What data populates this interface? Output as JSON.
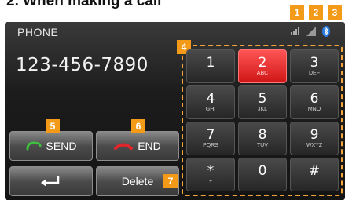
{
  "heading": "2. When making a call",
  "screen": {
    "title": "PHONE",
    "number": "123-456-7890"
  },
  "status_icons": [
    "signal-strength-icon",
    "battery-icon",
    "bluetooth-icon"
  ],
  "callouts": [
    "1",
    "2",
    "3",
    "4",
    "5",
    "6",
    "7"
  ],
  "keypad": [
    {
      "digit": "1",
      "letters": ""
    },
    {
      "digit": "2",
      "letters": "ABC"
    },
    {
      "digit": "3",
      "letters": "DEF"
    },
    {
      "digit": "4",
      "letters": "GHI"
    },
    {
      "digit": "5",
      "letters": "JKL"
    },
    {
      "digit": "6",
      "letters": "MNO"
    },
    {
      "digit": "7",
      "letters": "PQRS"
    },
    {
      "digit": "8",
      "letters": "TUV"
    },
    {
      "digit": "9",
      "letters": "WXYZ"
    },
    {
      "digit": "*",
      "letters": "+"
    },
    {
      "digit": "0",
      "letters": ""
    },
    {
      "digit": "#",
      "letters": ""
    }
  ],
  "pressed_key": "2",
  "buttons": {
    "send": "SEND",
    "end": "END",
    "delete": "Delete"
  },
  "colors": {
    "send_icon": "#3fbf3f",
    "end_icon": "#e0262b",
    "callout": "#f39a18",
    "active_key": "#e52121"
  }
}
